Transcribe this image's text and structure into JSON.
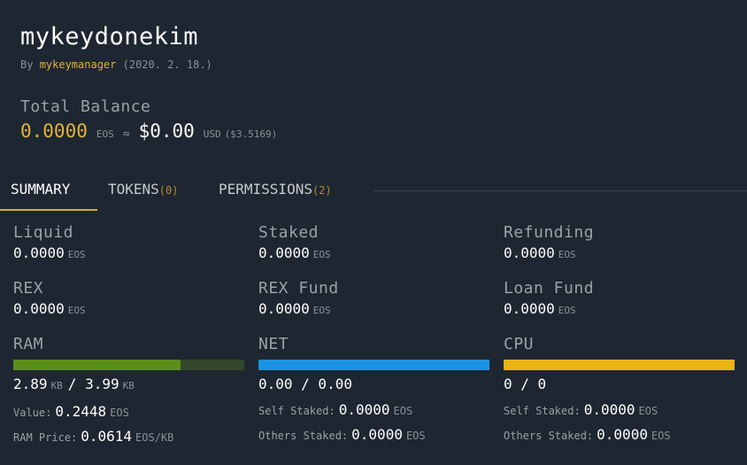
{
  "account": {
    "name": "mykeydonekim",
    "by_prefix": "By",
    "owner": "mykeymanager",
    "date": "(2020. 2. 18.)"
  },
  "balance": {
    "label": "Total Balance",
    "eos": "0.0000",
    "eos_unit": "EOS",
    "approx": "≈",
    "usd": "$0.00",
    "usd_unit": "USD",
    "usd_rate": "($3.5169)"
  },
  "tabs": [
    {
      "label": "SUMMARY",
      "count": ""
    },
    {
      "label": "TOKENS",
      "count": "(0)"
    },
    {
      "label": "PERMISSIONS",
      "count": "(2)"
    }
  ],
  "summary": {
    "liquid": {
      "label": "Liquid",
      "value": "0.0000",
      "unit": "EOS"
    },
    "staked": {
      "label": "Staked",
      "value": "0.0000",
      "unit": "EOS"
    },
    "refunding": {
      "label": "Refunding",
      "value": "0.0000",
      "unit": "EOS"
    },
    "rex": {
      "label": "REX",
      "value": "0.0000",
      "unit": "EOS"
    },
    "rex_fund": {
      "label": "REX Fund",
      "value": "0.0000",
      "unit": "EOS"
    },
    "loan_fund": {
      "label": "Loan Fund",
      "value": "0.0000",
      "unit": "EOS"
    }
  },
  "resources": {
    "ram": {
      "label": "RAM",
      "used": "2.89",
      "used_unit": "KB",
      "sep": "/",
      "total": "3.99",
      "total_unit": "KB",
      "usage_fraction": 0.724,
      "color": "#5a8f1a",
      "track_color": "#33472a",
      "value_label": "Value:",
      "value": "0.2448",
      "value_unit": "EOS",
      "price_label": "RAM Price:",
      "price": "0.0614",
      "price_unit": "EOS/KB"
    },
    "net": {
      "label": "NET",
      "usage_text": "0.00 / 0.00",
      "usage_fraction": 1.0,
      "color": "#1a94e6",
      "self_label": "Self Staked:",
      "self_value": "0.0000",
      "self_unit": "EOS",
      "others_label": "Others Staked:",
      "others_value": "0.0000",
      "others_unit": "EOS"
    },
    "cpu": {
      "label": "CPU",
      "usage_text": "0 / 0",
      "usage_fraction": 1.0,
      "color": "#eab415",
      "self_label": "Self Staked:",
      "self_value": "0.0000",
      "self_unit": "EOS",
      "others_label": "Others Staked:",
      "others_value": "0.0000",
      "others_unit": "EOS"
    }
  },
  "colors": {
    "background": "#1e2631",
    "accent": "#e2b33a"
  }
}
